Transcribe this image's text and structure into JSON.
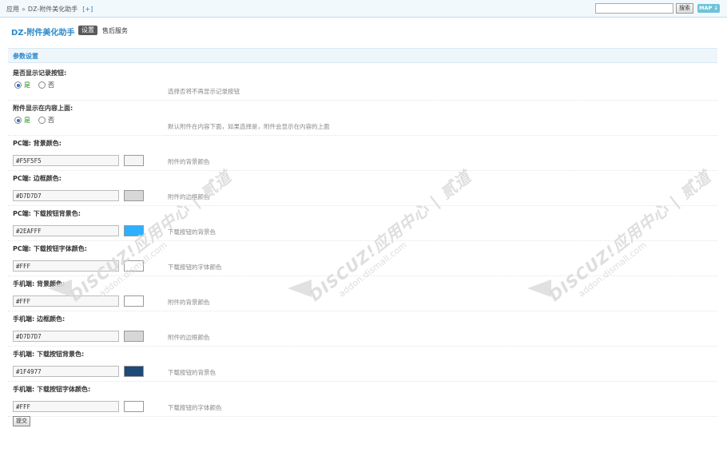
{
  "breadcrumb": {
    "root": "应用",
    "separator": "»",
    "current": "DZ-附件美化助手",
    "add": "[+]"
  },
  "search": {
    "value": "",
    "button_label": "搜索"
  },
  "map_button": "MAP ↓",
  "plugin": {
    "title": "DZ-附件美化助手",
    "tab_settings": "设置",
    "tab_aftersales": "售后服务"
  },
  "section": {
    "title": "参数设置"
  },
  "settings": [
    {
      "label": "是否显示记录按钮:",
      "type": "radio",
      "options": [
        "是",
        "否"
      ],
      "selected": "是",
      "description": "选择否将不再显示记录按钮"
    },
    {
      "label": "附件显示在内容上面:",
      "type": "radio",
      "options": [
        "是",
        "否"
      ],
      "selected": "是",
      "description": "默认附件在内容下面，如果选择是，附件会显示在内容的上面"
    },
    {
      "label": "PC端: 背景颜色:",
      "type": "color",
      "value": "#F5F5F5",
      "swatch": "#F5F5F5",
      "description": "附件的背景颜色"
    },
    {
      "label": "PC端: 边框颜色:",
      "type": "color",
      "value": "#D7D7D7",
      "swatch": "#D7D7D7",
      "description": "附件的边框颜色"
    },
    {
      "label": "PC端: 下载按钮背景色:",
      "type": "color",
      "value": "#2EAFFF",
      "swatch": "#2EAFFF",
      "description": "下载按钮的背景色"
    },
    {
      "label": "PC端: 下载按钮字体颜色:",
      "type": "color",
      "value": "#FFF",
      "swatch": "#FFFFFF",
      "description": "下载按钮的字体颜色"
    },
    {
      "label": "手机端: 背景颜色:",
      "type": "color",
      "value": "#FFF",
      "swatch": "#FFFFFF",
      "description": "附件的背景颜色"
    },
    {
      "label": "手机端: 边框颜色:",
      "type": "color",
      "value": "#D7D7D7",
      "swatch": "#D7D7D7",
      "description": "附件的边框颜色"
    },
    {
      "label": "手机端: 下载按钮背景色:",
      "type": "color",
      "value": "#1F4977",
      "swatch": "#1F4977",
      "description": "下载按钮的背景色"
    },
    {
      "label": "手机端: 下载按钮字体颜色:",
      "type": "color",
      "value": "#FFF",
      "swatch": "#FFFFFF",
      "description": "下载按钮的字体颜色"
    }
  ],
  "submit_label": "提交",
  "watermark": {
    "main": "DISCUZ!应用中心 | 贰道",
    "sub": "addon.dismall.com"
  },
  "colors": {
    "accent": "#2b89c9",
    "header_bg": "#eef6fc"
  }
}
